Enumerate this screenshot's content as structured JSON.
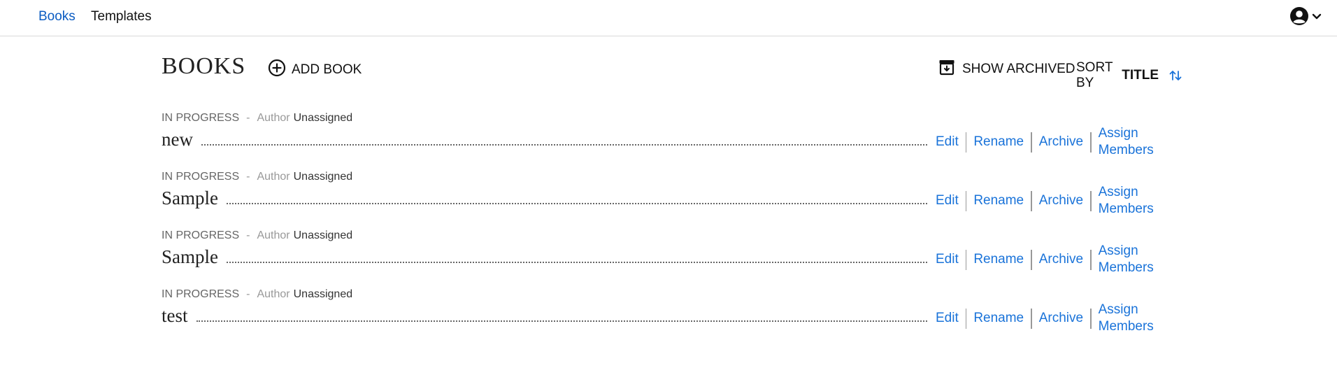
{
  "nav": {
    "books_label": "Books",
    "templates_label": "Templates",
    "active": "Books",
    "accent_color": "#0b5cc2"
  },
  "header": {
    "title": "BOOKS",
    "add_book_label": "ADD BOOK",
    "show_archived_label": "SHOW ARCHIVED",
    "sort_by_label": "SORT BY",
    "sort_field": "TITLE"
  },
  "icons": {
    "user": "user-circle-icon",
    "chevron": "chevron-down-icon",
    "add": "plus-circle-icon",
    "archive": "archive-box-icon",
    "sort": "sort-arrows-icon"
  },
  "books": [
    {
      "status": "IN PROGRESS",
      "author_label": "Author",
      "author": "Unassigned",
      "title": "new",
      "actions": [
        "Edit",
        "Rename",
        "Archive",
        "Assign Members"
      ]
    },
    {
      "status": "IN PROGRESS",
      "author_label": "Author",
      "author": "Unassigned",
      "title": "Sample",
      "actions": [
        "Edit",
        "Rename",
        "Archive",
        "Assign Members"
      ]
    },
    {
      "status": "IN PROGRESS",
      "author_label": "Author",
      "author": "Unassigned",
      "title": "Sample",
      "actions": [
        "Edit",
        "Rename",
        "Archive",
        "Assign Members"
      ]
    },
    {
      "status": "IN PROGRESS",
      "author_label": "Author",
      "author": "Unassigned",
      "title": "test",
      "actions": [
        "Edit",
        "Rename",
        "Archive",
        "Assign Members"
      ]
    }
  ],
  "colors": {
    "link": "#1a73d9",
    "text": "#222222",
    "muted": "#999999"
  }
}
